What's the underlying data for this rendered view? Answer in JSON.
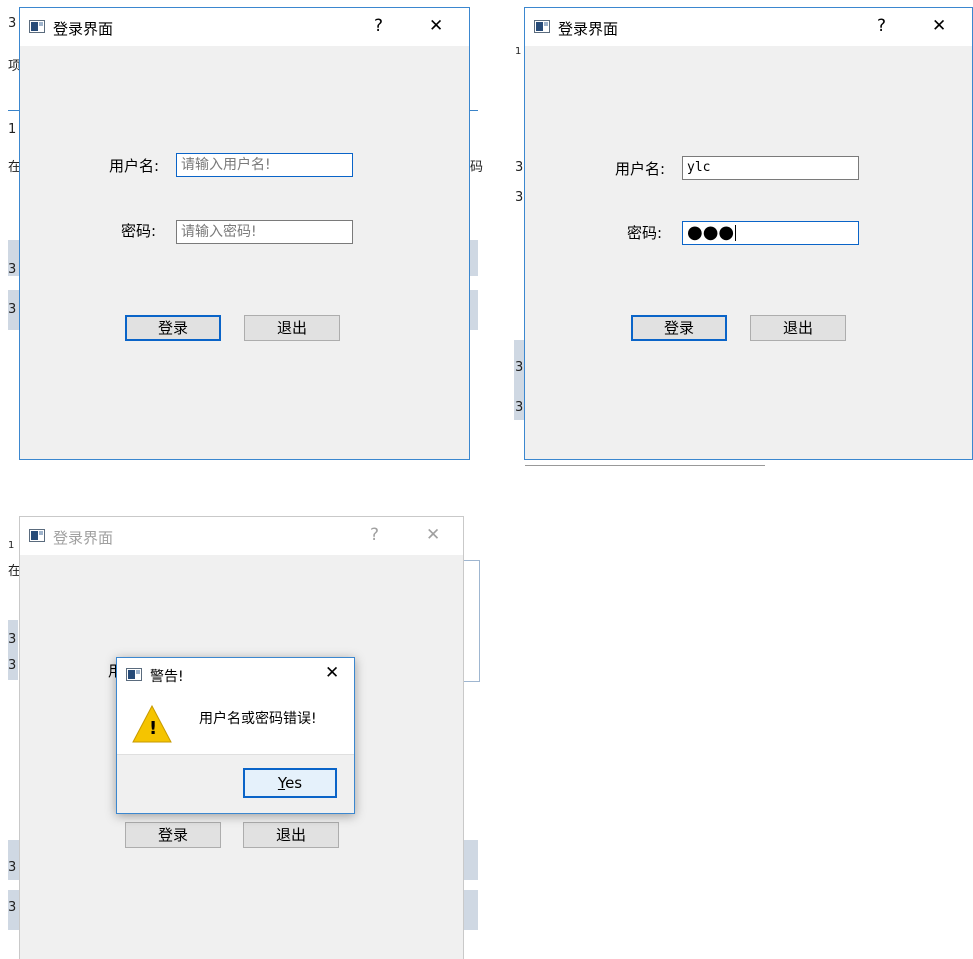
{
  "screen1": {
    "title": "登录界面",
    "help": "?",
    "close": "✕",
    "username_label": "用户名:",
    "username_placeholder": "请输入用户名!",
    "password_label": "密码:",
    "password_placeholder": "请输入密码!",
    "login_button": "登录",
    "exit_button": "退出"
  },
  "screen2": {
    "title": "登录界面",
    "help": "?",
    "close": "✕",
    "username_label": "用户名:",
    "username_value": "ylc",
    "password_label": "密码:",
    "password_mask": "●●●",
    "login_button": "登录",
    "exit_button": "退出"
  },
  "screen3": {
    "title": "登录界面",
    "help": "?",
    "close": "✕",
    "login_button": "登录",
    "exit_button": "退出",
    "partial_label": "用"
  },
  "warning_dialog": {
    "title": "警告!",
    "close": "✕",
    "message": "用户名或密码错误!",
    "icon_glyph": "!",
    "yes_underlined": "Y",
    "yes_rest": "es"
  },
  "background": {
    "chars": [
      "3",
      "项",
      "1",
      "在",
      "3",
      "3",
      "码",
      "1",
      "3",
      "3",
      "3",
      "3",
      "1",
      "在",
      "3",
      "3",
      "3",
      "3"
    ]
  },
  "colors": {
    "accent": "#0a64c8",
    "window_border": "#3b87cf",
    "dialog_bg": "#f0f0f0",
    "warning_yellow": "#f5c400"
  }
}
